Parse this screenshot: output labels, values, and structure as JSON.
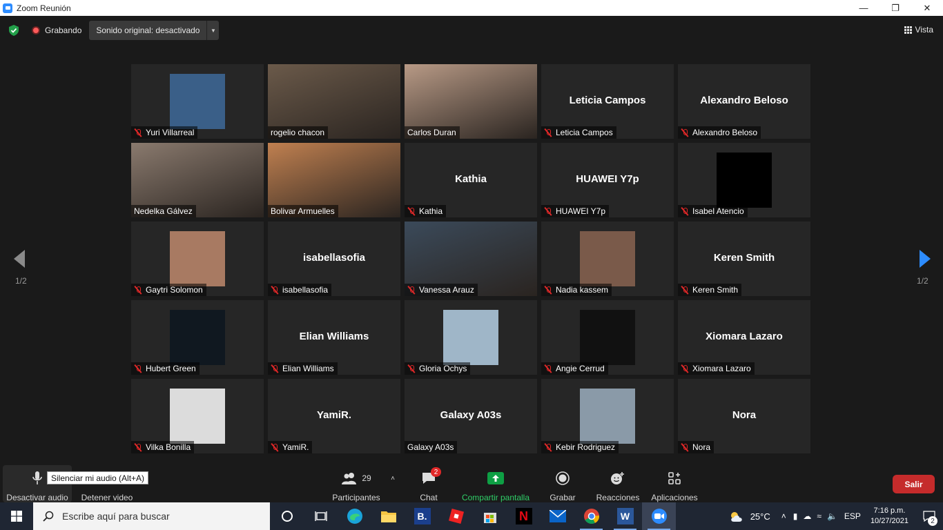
{
  "window": {
    "title": "Zoom Reunión"
  },
  "topbar": {
    "recording_label": "Grabando",
    "original_sound_label": "Sonido original: desactivado",
    "view_label": "Vista"
  },
  "participants": [
    {
      "name": "Yuri Villarreal",
      "muted": true,
      "kind": "photo",
      "bg": "#3a5f88"
    },
    {
      "name": "rogelio chacon",
      "muted": false,
      "kind": "video",
      "bg": "#6b5a4a"
    },
    {
      "name": "Carlos Duran",
      "muted": false,
      "kind": "video",
      "bg": "#b89a86"
    },
    {
      "name": "Leticia Campos",
      "muted": true,
      "kind": "text"
    },
    {
      "name": "Alexandro Beloso",
      "muted": true,
      "kind": "text"
    },
    {
      "name": "Nedelka Gálvez",
      "muted": false,
      "kind": "video",
      "bg": "#8a7a6e"
    },
    {
      "name": "Bolivar Armuelles",
      "muted": false,
      "kind": "video",
      "bg": "#c08050",
      "speaking": true
    },
    {
      "name": "Kathia",
      "muted": true,
      "kind": "text"
    },
    {
      "name": "HUAWEI Y7p",
      "muted": true,
      "kind": "text"
    },
    {
      "name": "Isabel Atencio",
      "muted": true,
      "kind": "photo",
      "bg": "#000000"
    },
    {
      "name": "Gaytri Solomon",
      "muted": true,
      "kind": "photo",
      "bg": "#a87a62"
    },
    {
      "name": "isabellasofia",
      "muted": true,
      "kind": "text"
    },
    {
      "name": "Vanessa Arauz",
      "muted": true,
      "kind": "video",
      "bg": "#3b4a5a"
    },
    {
      "name": "Nadia kassem",
      "muted": true,
      "kind": "photo",
      "bg": "#7a5a4a"
    },
    {
      "name": "Keren Smith",
      "muted": true,
      "kind": "text"
    },
    {
      "name": "Hubert Green",
      "muted": true,
      "kind": "photo",
      "bg": "#101820"
    },
    {
      "name": "Elian Williams",
      "muted": true,
      "kind": "text"
    },
    {
      "name": "Gloria Ochys",
      "muted": true,
      "kind": "photo",
      "bg": "#9fb6c8"
    },
    {
      "name": "Angie Cerrud",
      "muted": true,
      "kind": "photo",
      "bg": "#111111"
    },
    {
      "name": "Xiomara Lazaro",
      "muted": true,
      "kind": "text"
    },
    {
      "name": "Vilka Bonilla",
      "muted": true,
      "kind": "photo",
      "bg": "#dcdcdc"
    },
    {
      "name": "YamiR.",
      "muted": true,
      "kind": "text"
    },
    {
      "name": "Galaxy A03s",
      "muted": false,
      "kind": "text"
    },
    {
      "name": "Kebir Rodriguez",
      "muted": true,
      "kind": "photo",
      "bg": "#8a9aa8"
    },
    {
      "name": "Nora",
      "muted": true,
      "kind": "text"
    }
  ],
  "pager": {
    "left": "1/2",
    "right": "1/2"
  },
  "toolbar": {
    "mute_label": "Desactivar audio",
    "mute_tooltip": "Silenciar mi audio (Alt+A)",
    "video_label": "Detener video",
    "participants_label": "Participantes",
    "participants_count": "29",
    "chat_label": "Chat",
    "chat_badge": "2",
    "share_label": "Compartir pantalla",
    "record_label": "Grabar",
    "reactions_label": "Reacciones",
    "apps_label": "Aplicaciones",
    "leave_label": "Salir"
  },
  "taskbar": {
    "search_placeholder": "Escribe aquí para buscar",
    "temperature": "25°C",
    "language": "ESP",
    "time": "7:16 p.m.",
    "date": "10/27/2021",
    "notifications": "2"
  },
  "colors": {
    "share_green": "#0e9f44",
    "leave_red": "#c52b2b",
    "speaking_outline": "#e8ef79",
    "zoom_blue": "#2d8cff"
  }
}
